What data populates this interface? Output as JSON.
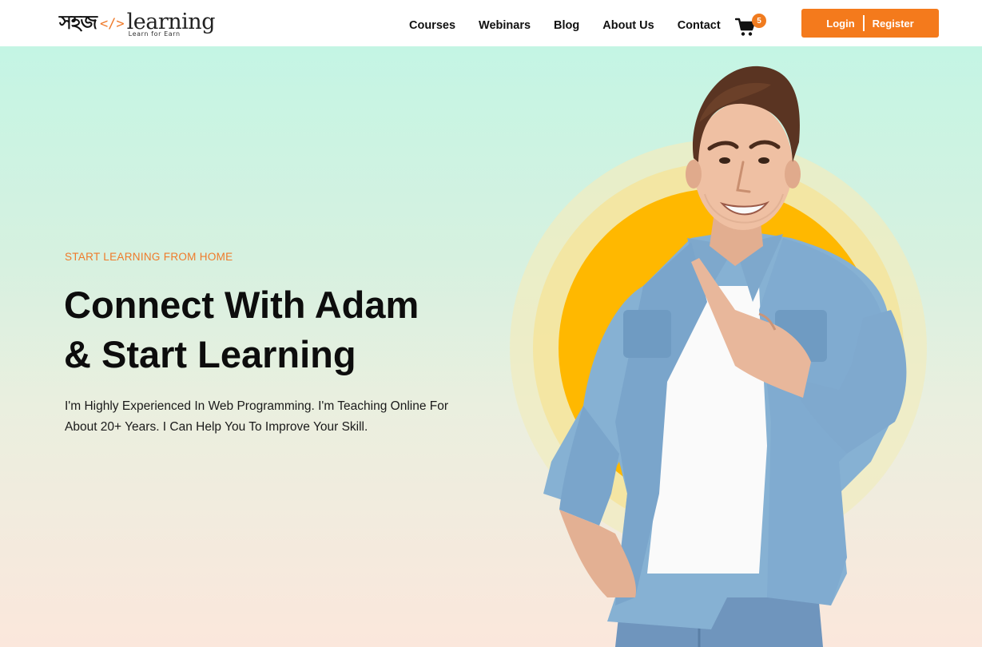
{
  "brand": {
    "bn_name": "সহজ",
    "code_mark": "</>",
    "name": "learning",
    "tagline": "Learn for Earn"
  },
  "nav": {
    "items": [
      {
        "label": "Courses"
      },
      {
        "label": "Webinars"
      },
      {
        "label": "Blog"
      },
      {
        "label": "About Us"
      },
      {
        "label": "Contact"
      }
    ]
  },
  "cart": {
    "count": "5",
    "icon": "cart-icon"
  },
  "auth": {
    "login_label": "Login",
    "register_label": "Register"
  },
  "hero": {
    "eyebrow": "START LEARNING FROM HOME",
    "headline_line1": "Connect With Adam",
    "headline_line2": "& Start Learning",
    "description_line1": "I'm Highly Experienced In Web Programming. I'm Teaching Online For",
    "description_line2": "About 20+ Years. I Can Help You To Improve Your Skill."
  },
  "colors": {
    "accent": "#f47a1c",
    "text": "#0d0d0d",
    "sun": "#ffb800",
    "shirt": "#86b1d3"
  }
}
